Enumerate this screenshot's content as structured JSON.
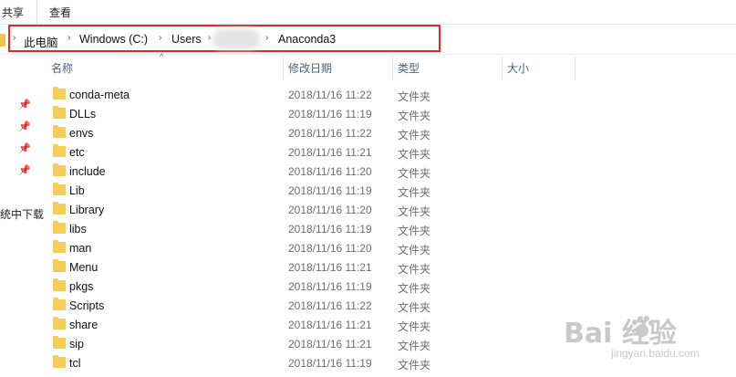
{
  "ribbon": {
    "tabs": [
      "共享",
      "查看"
    ]
  },
  "address": {
    "crumbs": [
      "此电脑",
      "Windows (C:)",
      "Users",
      "Anaconda3"
    ]
  },
  "columns": [
    "名称",
    "修改日期",
    "类型",
    "大小"
  ],
  "nav": {
    "partial_label": "统中下载"
  },
  "files": [
    {
      "name": "conda-meta",
      "date": "2018/11/16 11:22",
      "type": "文件夹"
    },
    {
      "name": "DLLs",
      "date": "2018/11/16 11:19",
      "type": "文件夹"
    },
    {
      "name": "envs",
      "date": "2018/11/16 11:22",
      "type": "文件夹"
    },
    {
      "name": "etc",
      "date": "2018/11/16 11:21",
      "type": "文件夹"
    },
    {
      "name": "include",
      "date": "2018/11/16 11:20",
      "type": "文件夹"
    },
    {
      "name": "Lib",
      "date": "2018/11/16 11:19",
      "type": "文件夹"
    },
    {
      "name": "Library",
      "date": "2018/11/16 11:20",
      "type": "文件夹"
    },
    {
      "name": "libs",
      "date": "2018/11/16 11:19",
      "type": "文件夹"
    },
    {
      "name": "man",
      "date": "2018/11/16 11:20",
      "type": "文件夹"
    },
    {
      "name": "Menu",
      "date": "2018/11/16 11:21",
      "type": "文件夹"
    },
    {
      "name": "pkgs",
      "date": "2018/11/16 11:19",
      "type": "文件夹"
    },
    {
      "name": "Scripts",
      "date": "2018/11/16 11:22",
      "type": "文件夹"
    },
    {
      "name": "share",
      "date": "2018/11/16 11:21",
      "type": "文件夹"
    },
    {
      "name": "sip",
      "date": "2018/11/16 11:21",
      "type": "文件夹"
    },
    {
      "name": "tcl",
      "date": "2018/11/16 11:19",
      "type": "文件夹"
    }
  ],
  "watermark": {
    "main": "Bai  经验",
    "sub": "jingyan.baidu.com"
  },
  "colors": {
    "highlight": "#e02a2a",
    "folder": "#f5ce5a",
    "header_text": "#4d6082"
  }
}
